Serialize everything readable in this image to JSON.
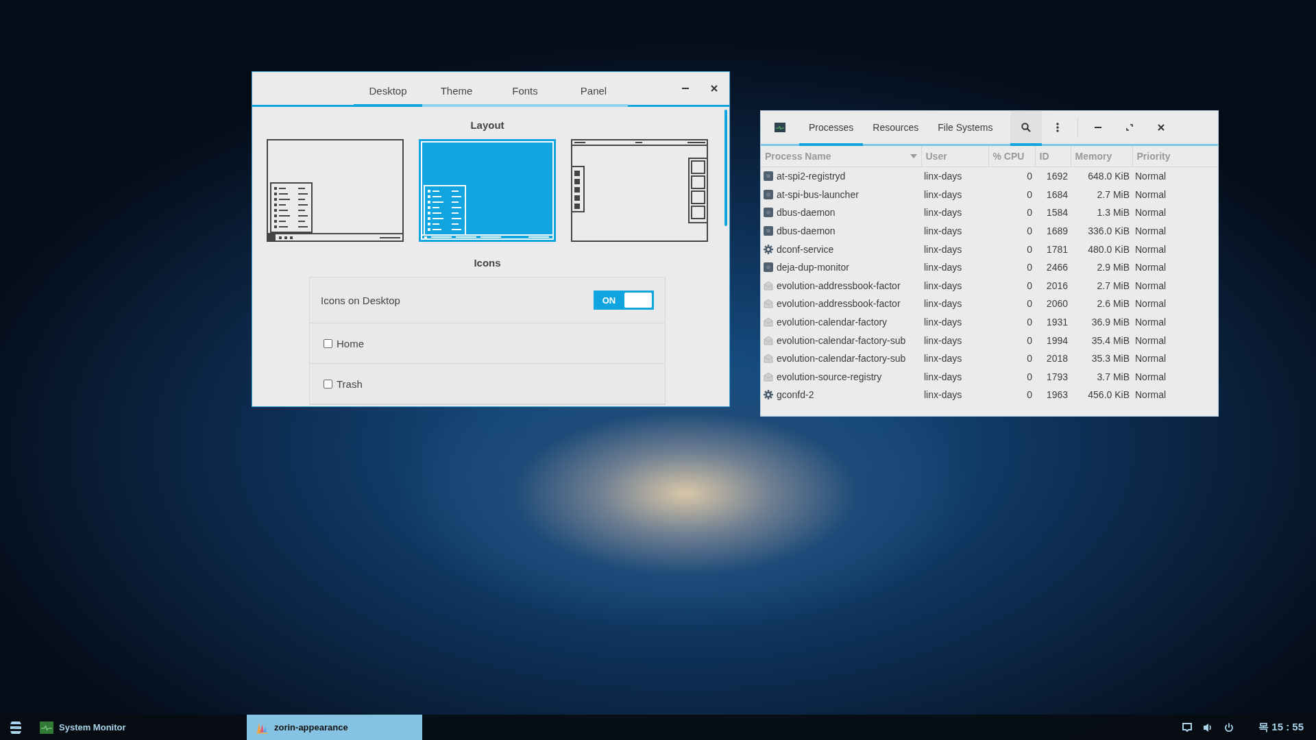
{
  "appearance": {
    "tabs": [
      {
        "label": "Desktop",
        "selected": true
      },
      {
        "label": "Theme",
        "selected": false
      },
      {
        "label": "Fonts",
        "selected": false
      },
      {
        "label": "Panel",
        "selected": false
      }
    ],
    "layout_heading": "Layout",
    "layouts": [
      {
        "kind": "bottom-panel",
        "selected": false
      },
      {
        "kind": "bottom-panel-wide",
        "selected": true
      },
      {
        "kind": "top-panel-docks",
        "selected": false
      }
    ],
    "icons_heading": "Icons",
    "icons_on_desktop": {
      "label": "Icons on Desktop",
      "toggle_text": "ON",
      "on": true
    },
    "checkboxes": [
      {
        "label": "Home",
        "checked": false
      },
      {
        "label": "Trash",
        "checked": false
      }
    ]
  },
  "system_monitor": {
    "tabs": [
      {
        "label": "Processes",
        "selected": true
      },
      {
        "label": "Resources",
        "selected": false
      },
      {
        "label": "File Systems",
        "selected": false
      }
    ],
    "columns": [
      "Process Name",
      "User",
      "% CPU",
      "ID",
      "Memory",
      "Priority"
    ],
    "rows": [
      {
        "kind": "app",
        "name": "at-spi2-registryd",
        "user": "linx-days",
        "cpu": "0",
        "id": "1692",
        "memory": "648.0 KiB",
        "priority": "Normal"
      },
      {
        "kind": "app",
        "name": "at-spi-bus-launcher",
        "user": "linx-days",
        "cpu": "0",
        "id": "1684",
        "memory": "2.7 MiB",
        "priority": "Normal"
      },
      {
        "kind": "app",
        "name": "dbus-daemon",
        "user": "linx-days",
        "cpu": "0",
        "id": "1584",
        "memory": "1.3 MiB",
        "priority": "Normal"
      },
      {
        "kind": "app",
        "name": "dbus-daemon",
        "user": "linx-days",
        "cpu": "0",
        "id": "1689",
        "memory": "336.0 KiB",
        "priority": "Normal"
      },
      {
        "kind": "gear",
        "name": "dconf-service",
        "user": "linx-days",
        "cpu": "0",
        "id": "1781",
        "memory": "480.0 KiB",
        "priority": "Normal"
      },
      {
        "kind": "app",
        "name": "deja-dup-monitor",
        "user": "linx-days",
        "cpu": "0",
        "id": "2466",
        "memory": "2.9 MiB",
        "priority": "Normal"
      },
      {
        "kind": "mail",
        "name": "evolution-addressbook-factor",
        "user": "linx-days",
        "cpu": "0",
        "id": "2016",
        "memory": "2.7 MiB",
        "priority": "Normal"
      },
      {
        "kind": "mail",
        "name": "evolution-addressbook-factor",
        "user": "linx-days",
        "cpu": "0",
        "id": "2060",
        "memory": "2.6 MiB",
        "priority": "Normal"
      },
      {
        "kind": "mail",
        "name": "evolution-calendar-factory",
        "user": "linx-days",
        "cpu": "0",
        "id": "1931",
        "memory": "36.9 MiB",
        "priority": "Normal"
      },
      {
        "kind": "mail",
        "name": "evolution-calendar-factory-sub",
        "user": "linx-days",
        "cpu": "0",
        "id": "1994",
        "memory": "35.4 MiB",
        "priority": "Normal"
      },
      {
        "kind": "mail",
        "name": "evolution-calendar-factory-sub",
        "user": "linx-days",
        "cpu": "0",
        "id": "2018",
        "memory": "35.3 MiB",
        "priority": "Normal"
      },
      {
        "kind": "mail",
        "name": "evolution-source-registry",
        "user": "linx-days",
        "cpu": "0",
        "id": "1793",
        "memory": "3.7 MiB",
        "priority": "Normal"
      },
      {
        "kind": "gear",
        "name": "gconfd-2",
        "user": "linx-days",
        "cpu": "0",
        "id": "1963",
        "memory": "456.0 KiB",
        "priority": "Normal"
      }
    ]
  },
  "taskbar": {
    "apps": [
      {
        "label": "System Monitor",
        "selected": false
      },
      {
        "label": "zorin-appearance",
        "selected": true
      }
    ],
    "clock": "목 15 : 55"
  }
}
